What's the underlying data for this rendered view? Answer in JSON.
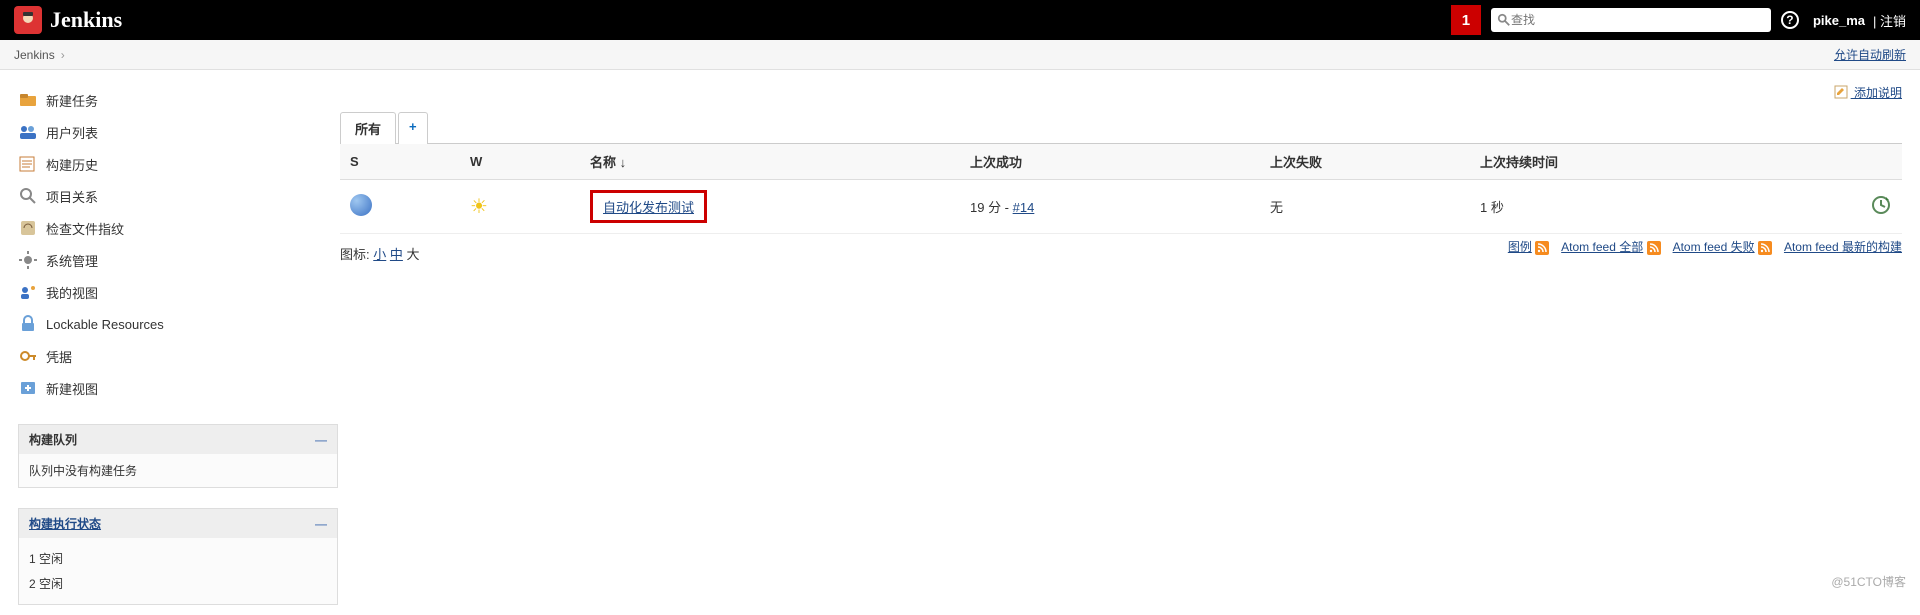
{
  "header": {
    "logo_text": "Jenkins",
    "notif_count": "1",
    "search_placeholder": "查找",
    "username": "pike_ma",
    "logout": "| 注销"
  },
  "breadcrumb": {
    "root": "Jenkins",
    "auto_refresh": "允许自动刷新"
  },
  "sidebar": {
    "tasks": [
      {
        "label": "新建任务",
        "icon": "new",
        "color": "#e8a33d"
      },
      {
        "label": "用户列表",
        "icon": "people",
        "color": "#3b72c4"
      },
      {
        "label": "构建历史",
        "icon": "history",
        "color": "#c77d3a"
      },
      {
        "label": "项目关系",
        "icon": "search",
        "color": "#9aa0a6"
      },
      {
        "label": "检查文件指纹",
        "icon": "fingerprint",
        "color": "#7a5c3c"
      },
      {
        "label": "系统管理",
        "icon": "gear",
        "color": "#888"
      },
      {
        "label": "我的视图",
        "icon": "myview",
        "color": "#3b72c4"
      },
      {
        "label": "Lockable Resources",
        "icon": "lock",
        "color": "#6aa0d8"
      },
      {
        "label": "凭据",
        "icon": "creds",
        "color": "#cc8a2a"
      },
      {
        "label": "新建视图",
        "icon": "newview",
        "color": "#6aa0d8"
      }
    ],
    "queue": {
      "title": "构建队列",
      "empty": "队列中没有构建任务"
    },
    "executors": {
      "title": "构建执行状态",
      "rows": [
        {
          "num": "1",
          "state": "空闲"
        },
        {
          "num": "2",
          "state": "空闲"
        }
      ]
    }
  },
  "main": {
    "add_description": "添加说明",
    "tabs": {
      "all": "所有",
      "add": "+"
    },
    "columns": {
      "s": "S",
      "w": "W",
      "name": "名称 ↓",
      "last_success": "上次成功",
      "last_failure": "上次失败",
      "duration": "上次持续时间"
    },
    "rows": [
      {
        "name": "自动化发布测试",
        "last_success_prefix": "19 分 - ",
        "last_success_build": "#14",
        "last_failure": "无",
        "duration": "1 秒"
      }
    ],
    "icon_sizes": {
      "label": "图标:",
      "s": "小",
      "m": "中",
      "l": "大"
    },
    "feeds": {
      "legend": "图例",
      "all": "Atom feed 全部",
      "fail": "Atom feed 失败",
      "latest": "Atom feed 最新的构建"
    }
  },
  "watermark": "@51CTO博客"
}
